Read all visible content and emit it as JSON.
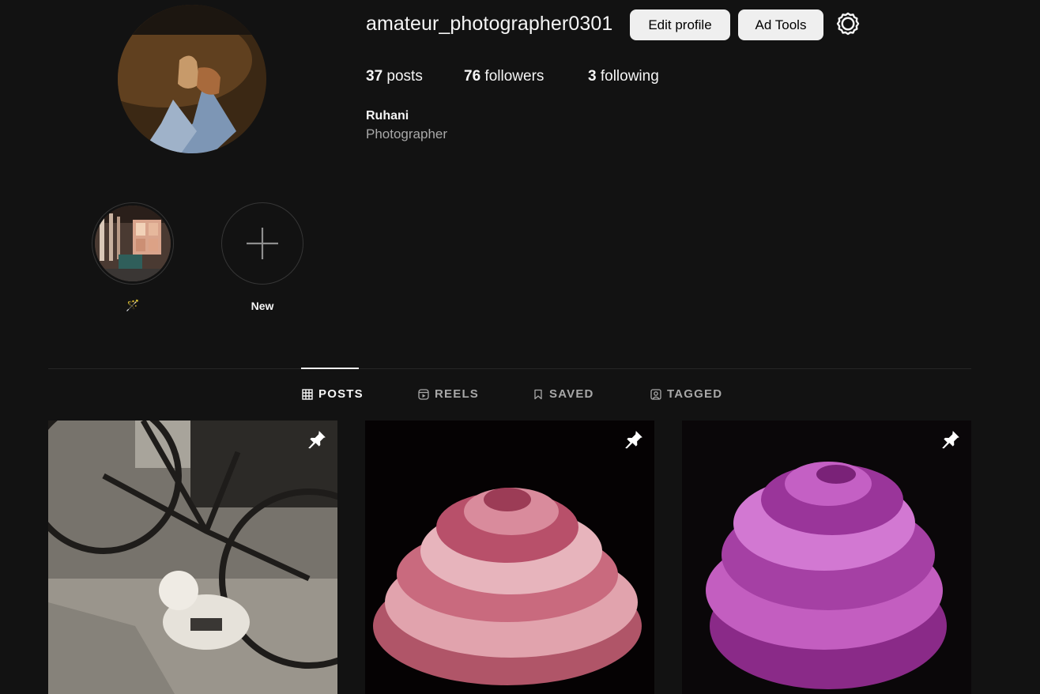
{
  "profile": {
    "username": "amateur_photographer0301",
    "edit_profile_label": "Edit profile",
    "ad_tools_label": "Ad Tools",
    "settings_icon": "gear-icon",
    "stats": {
      "posts_count": "37",
      "posts_label": "posts",
      "followers_count": "76",
      "followers_label": "followers",
      "following_count": "3",
      "following_label": "following"
    },
    "full_name": "Ruhani",
    "bio": "Photographer"
  },
  "highlights": [
    {
      "label": "🪄",
      "icon": "magic-wand-emoji"
    },
    {
      "label": "New",
      "icon": "plus-icon"
    }
  ],
  "tabs": [
    {
      "label": "POSTS",
      "icon": "grid-icon",
      "active": true
    },
    {
      "label": "REELS",
      "icon": "reels-icon",
      "active": false
    },
    {
      "label": "SAVED",
      "icon": "bookmark-icon",
      "active": false
    },
    {
      "label": "TAGGED",
      "icon": "tagged-icon",
      "active": false
    }
  ],
  "posts": [
    {
      "subject": "bicycle-and-dog-sepia",
      "pinned": true
    },
    {
      "subject": "pink-rose-dark",
      "pinned": true
    },
    {
      "subject": "purple-rose-dark",
      "pinned": true
    }
  ],
  "colors": {
    "background": "#121212",
    "text_primary": "#f5f5f5",
    "text_secondary": "#a8a8a8",
    "button_bg": "#efefef",
    "divider": "#262626"
  }
}
